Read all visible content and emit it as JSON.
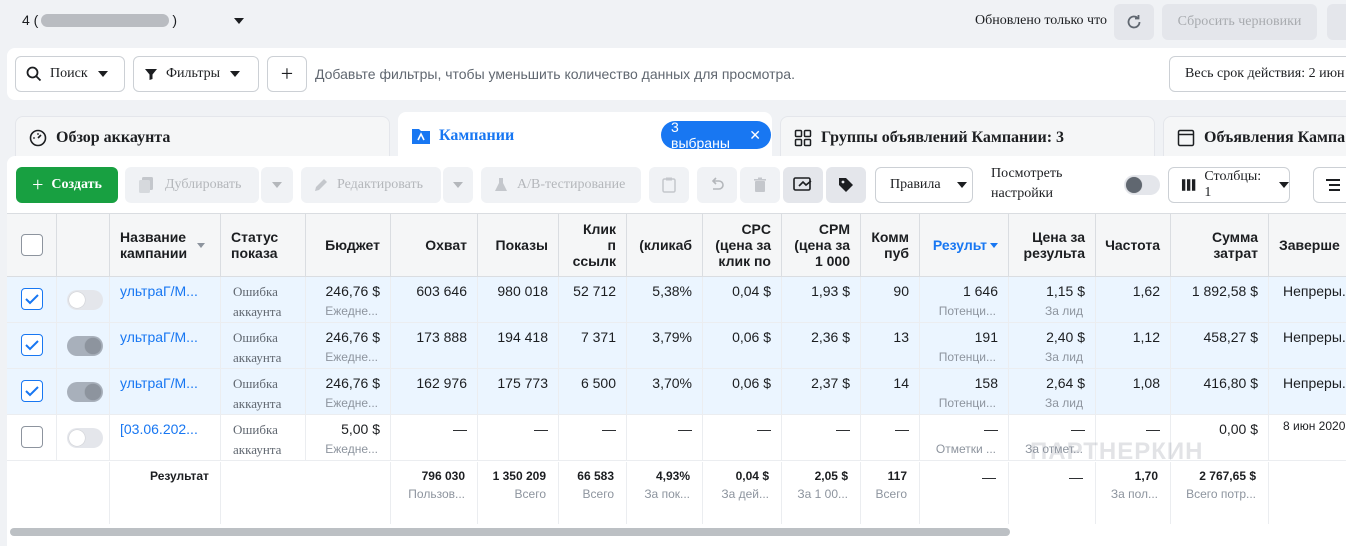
{
  "topbar": {
    "account_prefix": "4 (",
    "account_suffix": ")",
    "updated_label": "Обновлено только что",
    "reset_label": "Сбросить черновики"
  },
  "filterbar": {
    "search_label": "Поиск",
    "filters_label": "Фильтры",
    "add_label": "+",
    "hint": "Добавьте фильтры, чтобы уменьшить количество данных для просмотра.",
    "date_range": "Весь срок действия: 2 июн"
  },
  "level_tabs": {
    "overview": "Обзор аккаунта",
    "campaigns": "Кампании",
    "selected_pill": "3 выбраны",
    "adsets": "Группы объявлений Кампании: 3",
    "ads": "Объявления Кампа"
  },
  "toolbar": {
    "create": "Создать",
    "duplicate": "Дублировать",
    "edit": "Редактировать",
    "ab_test": "A/B-тестирование",
    "rules": "Правила",
    "view_settings_1": "Посмотреть",
    "view_settings_2": "настройки",
    "columns": "Столбцы: 1"
  },
  "table": {
    "headers": {
      "name": [
        "Название",
        "кампании"
      ],
      "status": [
        "Статус",
        "показа"
      ],
      "budget": "Бюджет",
      "reach": "Охват",
      "impressions": "Показы",
      "link_clicks": [
        "Клик",
        "п",
        "ссылк"
      ],
      "ctr": "(кликаб",
      "cpc": [
        "CPC",
        "(цена за",
        "клик по"
      ],
      "cpm": [
        "CPM",
        "(цена за",
        "1 000"
      ],
      "comments": [
        "Комм",
        "пуб"
      ],
      "results": "Результ",
      "cost_per_result": [
        "Цена за",
        "результа"
      ],
      "frequency": "Частота",
      "amount_spent": [
        "Сумма",
        "затрат"
      ],
      "ends": "Заверше"
    },
    "rows": [
      {
        "selected": true,
        "on": false,
        "name": "ультраГ/М...",
        "status": [
          "Ошибка",
          "аккаунта"
        ],
        "budget": "246,76 $",
        "budget_sub": "Ежедне...",
        "reach": "603 646",
        "impressions": "980 018",
        "link_clicks": "52 712",
        "ctr": "5,38%",
        "cpc": "0,04 $",
        "cpm": "1,93 $",
        "comments": "90",
        "results": "1 646",
        "results_sub": "Потенци...",
        "cost_per_result": "1,15 $",
        "cost_sub": "За лид",
        "frequency": "1,62",
        "spent": "1 892,58 $",
        "ends": "Непреры..."
      },
      {
        "selected": true,
        "on": true,
        "name": "ультраГ/М...",
        "status": [
          "Ошибка",
          "аккаунта"
        ],
        "budget": "246,76 $",
        "budget_sub": "Ежедне...",
        "reach": "173 888",
        "impressions": "194 418",
        "link_clicks": "7 371",
        "ctr": "3,79%",
        "cpc": "0,06 $",
        "cpm": "2,36 $",
        "comments": "13",
        "results": "191",
        "results_sub": "Потенци...",
        "cost_per_result": "2,40 $",
        "cost_sub": "За лид",
        "frequency": "1,12",
        "spent": "458,27 $",
        "ends": "Непреры..."
      },
      {
        "selected": true,
        "on": true,
        "name": "ультраГ/М...",
        "status": [
          "Ошибка",
          "аккаунта"
        ],
        "budget": "246,76 $",
        "budget_sub": "Ежедне...",
        "reach": "162 976",
        "impressions": "175 773",
        "link_clicks": "6 500",
        "ctr": "3,70%",
        "cpc": "0,06 $",
        "cpm": "2,37 $",
        "comments": "14",
        "results": "158",
        "results_sub": "Потенци...",
        "cost_per_result": "2,64 $",
        "cost_sub": "За лид",
        "frequency": "1,08",
        "spent": "416,80 $",
        "ends": "Непреры..."
      },
      {
        "selected": false,
        "on": false,
        "name": "[03.06.202...",
        "status": [
          "Ошибка",
          "аккаунта"
        ],
        "budget": "5,00 $",
        "budget_sub": "Ежедне...",
        "reach": "—",
        "impressions": "—",
        "link_clicks": "—",
        "ctr": "—",
        "cpc": "—",
        "cpm": "—",
        "comments": "—",
        "results": "—",
        "results_sub": "Отметки ...",
        "cost_per_result": "—",
        "cost_sub": "За отмет...",
        "frequency": "—",
        "spent": "0,00 $",
        "ends": "8 июн 2020"
      }
    ],
    "totals": {
      "label": "Результат",
      "reach": "796 030",
      "reach_sub": "Пользов...",
      "impressions": "1 350 209",
      "impressions_sub": "Всего",
      "link_clicks": "66 583",
      "link_clicks_sub": "Всего",
      "ctr": "4,93%",
      "ctr_sub": "За пок...",
      "cpc": "0,04 $",
      "cpc_sub": "За дей...",
      "cpm": "2,05 $",
      "cpm_sub": "За 1 00...",
      "comments": "117",
      "comments_sub": "Всего",
      "results": "—",
      "cost_per_result": "—",
      "frequency": "1,70",
      "frequency_sub": "За пол...",
      "spent": "2 767,65 $",
      "spent_sub": "Всего потр..."
    }
  },
  "watermark": "ПАРТНЕРКИН",
  "colors": {
    "accent": "#1877f2",
    "create": "#18a041",
    "selected_row": "#ebf5ff"
  }
}
